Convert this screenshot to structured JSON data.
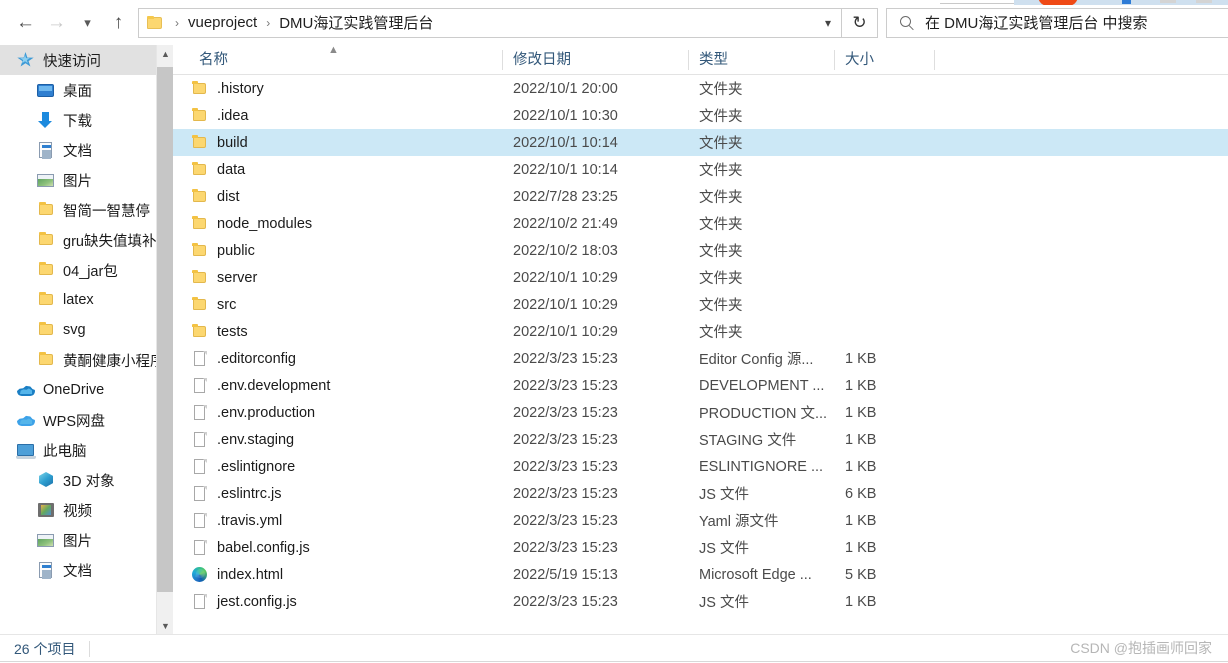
{
  "toolbar": {
    "back_icon": "arrow-left-icon",
    "forward_icon": "arrow-right-icon",
    "recent_icon": "chevron-down-icon",
    "up_icon": "arrow-up-icon",
    "refresh_icon": "refresh-icon",
    "address_dropdown_icon": "chevron-down-icon",
    "breadcrumb": {
      "folder_icon": "folder-icon",
      "separator": "›",
      "items": [
        "vueproject",
        "DMU海辽实践管理后台"
      ]
    },
    "search": {
      "icon": "search-icon",
      "placeholder": "在 DMU海辽实践管理后台 中搜索",
      "value": ""
    }
  },
  "sidebar": {
    "scroll_up_icon": "chevron-up-icon",
    "scroll_down_icon": "chevron-down-icon",
    "items": [
      {
        "label": "快速访问",
        "icon": "star-icon",
        "level": 0,
        "selected": true,
        "pinned": false
      },
      {
        "label": "桌面",
        "icon": "desktop-icon",
        "level": 1,
        "selected": false,
        "pinned": true
      },
      {
        "label": "下载",
        "icon": "download-icon",
        "level": 1,
        "selected": false,
        "pinned": true
      },
      {
        "label": "文档",
        "icon": "documents-icon",
        "level": 1,
        "selected": false,
        "pinned": true
      },
      {
        "label": "图片",
        "icon": "pictures-icon",
        "level": 1,
        "selected": false,
        "pinned": true
      },
      {
        "label": "智简一智慧停",
        "icon": "folder-icon",
        "level": 1,
        "selected": false,
        "pinned": true
      },
      {
        "label": "gru缺失值填补",
        "icon": "folder-icon",
        "level": 1,
        "selected": false,
        "pinned": true
      },
      {
        "label": "04_jar包",
        "icon": "folder-icon",
        "level": 1,
        "selected": false,
        "pinned": false
      },
      {
        "label": "latex",
        "icon": "folder-icon",
        "level": 1,
        "selected": false,
        "pinned": false
      },
      {
        "label": "svg",
        "icon": "folder-icon",
        "level": 1,
        "selected": false,
        "pinned": false
      },
      {
        "label": "黄酮健康小程序数",
        "icon": "folder-icon",
        "level": 1,
        "selected": false,
        "pinned": false
      },
      {
        "label": "OneDrive",
        "icon": "onedrive-icon",
        "level": 0,
        "selected": false,
        "pinned": false
      },
      {
        "label": "WPS网盘",
        "icon": "wps-cloud-icon",
        "level": 0,
        "selected": false,
        "pinned": false
      },
      {
        "label": "此电脑",
        "icon": "this-pc-icon",
        "level": 0,
        "selected": false,
        "pinned": false
      },
      {
        "label": "3D 对象",
        "icon": "3d-objects-icon",
        "level": 1,
        "selected": false,
        "pinned": false
      },
      {
        "label": "视频",
        "icon": "videos-icon",
        "level": 1,
        "selected": false,
        "pinned": false
      },
      {
        "label": "图片",
        "icon": "pictures-icon",
        "level": 1,
        "selected": false,
        "pinned": false
      },
      {
        "label": "文档",
        "icon": "documents-icon",
        "level": 1,
        "selected": false,
        "pinned": false
      }
    ]
  },
  "filelist": {
    "sort_caret_icon": "sort-ascending-icon",
    "columns": [
      "名称",
      "修改日期",
      "类型",
      "大小"
    ],
    "rows": [
      {
        "name": ".history",
        "date": "2022/10/1 20:00",
        "type": "文件夹",
        "size": "",
        "icon": "folder-icon",
        "selected": false
      },
      {
        "name": ".idea",
        "date": "2022/10/1 10:30",
        "type": "文件夹",
        "size": "",
        "icon": "folder-icon",
        "selected": false
      },
      {
        "name": "build",
        "date": "2022/10/1 10:14",
        "type": "文件夹",
        "size": "",
        "icon": "folder-icon",
        "selected": true
      },
      {
        "name": "data",
        "date": "2022/10/1 10:14",
        "type": "文件夹",
        "size": "",
        "icon": "folder-icon",
        "selected": false
      },
      {
        "name": "dist",
        "date": "2022/7/28 23:25",
        "type": "文件夹",
        "size": "",
        "icon": "folder-icon",
        "selected": false
      },
      {
        "name": "node_modules",
        "date": "2022/10/2 21:49",
        "type": "文件夹",
        "size": "",
        "icon": "folder-icon",
        "selected": false
      },
      {
        "name": "public",
        "date": "2022/10/2 18:03",
        "type": "文件夹",
        "size": "",
        "icon": "folder-icon",
        "selected": false
      },
      {
        "name": "server",
        "date": "2022/10/1 10:29",
        "type": "文件夹",
        "size": "",
        "icon": "folder-icon",
        "selected": false
      },
      {
        "name": "src",
        "date": "2022/10/1 10:29",
        "type": "文件夹",
        "size": "",
        "icon": "folder-icon",
        "selected": false
      },
      {
        "name": "tests",
        "date": "2022/10/1 10:29",
        "type": "文件夹",
        "size": "",
        "icon": "folder-icon",
        "selected": false
      },
      {
        "name": ".editorconfig",
        "date": "2022/3/23 15:23",
        "type": "Editor Config 源...",
        "size": "1 KB",
        "icon": "file-icon",
        "selected": false
      },
      {
        "name": ".env.development",
        "date": "2022/3/23 15:23",
        "type": "DEVELOPMENT ...",
        "size": "1 KB",
        "icon": "file-icon",
        "selected": false
      },
      {
        "name": ".env.production",
        "date": "2022/3/23 15:23",
        "type": "PRODUCTION 文...",
        "size": "1 KB",
        "icon": "file-icon",
        "selected": false
      },
      {
        "name": ".env.staging",
        "date": "2022/3/23 15:23",
        "type": "STAGING 文件",
        "size": "1 KB",
        "icon": "file-icon",
        "selected": false
      },
      {
        "name": ".eslintignore",
        "date": "2022/3/23 15:23",
        "type": "ESLINTIGNORE ...",
        "size": "1 KB",
        "icon": "file-icon",
        "selected": false
      },
      {
        "name": ".eslintrc.js",
        "date": "2022/3/23 15:23",
        "type": "JS 文件",
        "size": "6 KB",
        "icon": "file-icon",
        "selected": false
      },
      {
        "name": ".travis.yml",
        "date": "2022/3/23 15:23",
        "type": "Yaml 源文件",
        "size": "1 KB",
        "icon": "file-icon",
        "selected": false
      },
      {
        "name": "babel.config.js",
        "date": "2022/3/23 15:23",
        "type": "JS 文件",
        "size": "1 KB",
        "icon": "file-icon",
        "selected": false
      },
      {
        "name": "index.html",
        "date": "2022/5/19 15:13",
        "type": "Microsoft Edge ...",
        "size": "5 KB",
        "icon": "edge-icon",
        "selected": false
      },
      {
        "name": "jest.config.js",
        "date": "2022/3/23 15:23",
        "type": "JS 文件",
        "size": "1 KB",
        "icon": "file-icon",
        "selected": false
      }
    ]
  },
  "statusbar": {
    "item_count": "26 个项目"
  },
  "watermark": {
    "text": "CSDN @抱插画师回家"
  },
  "colors": {
    "selection": "#cce8f6",
    "header_text": "#33587a",
    "folder": "#fcd770"
  }
}
